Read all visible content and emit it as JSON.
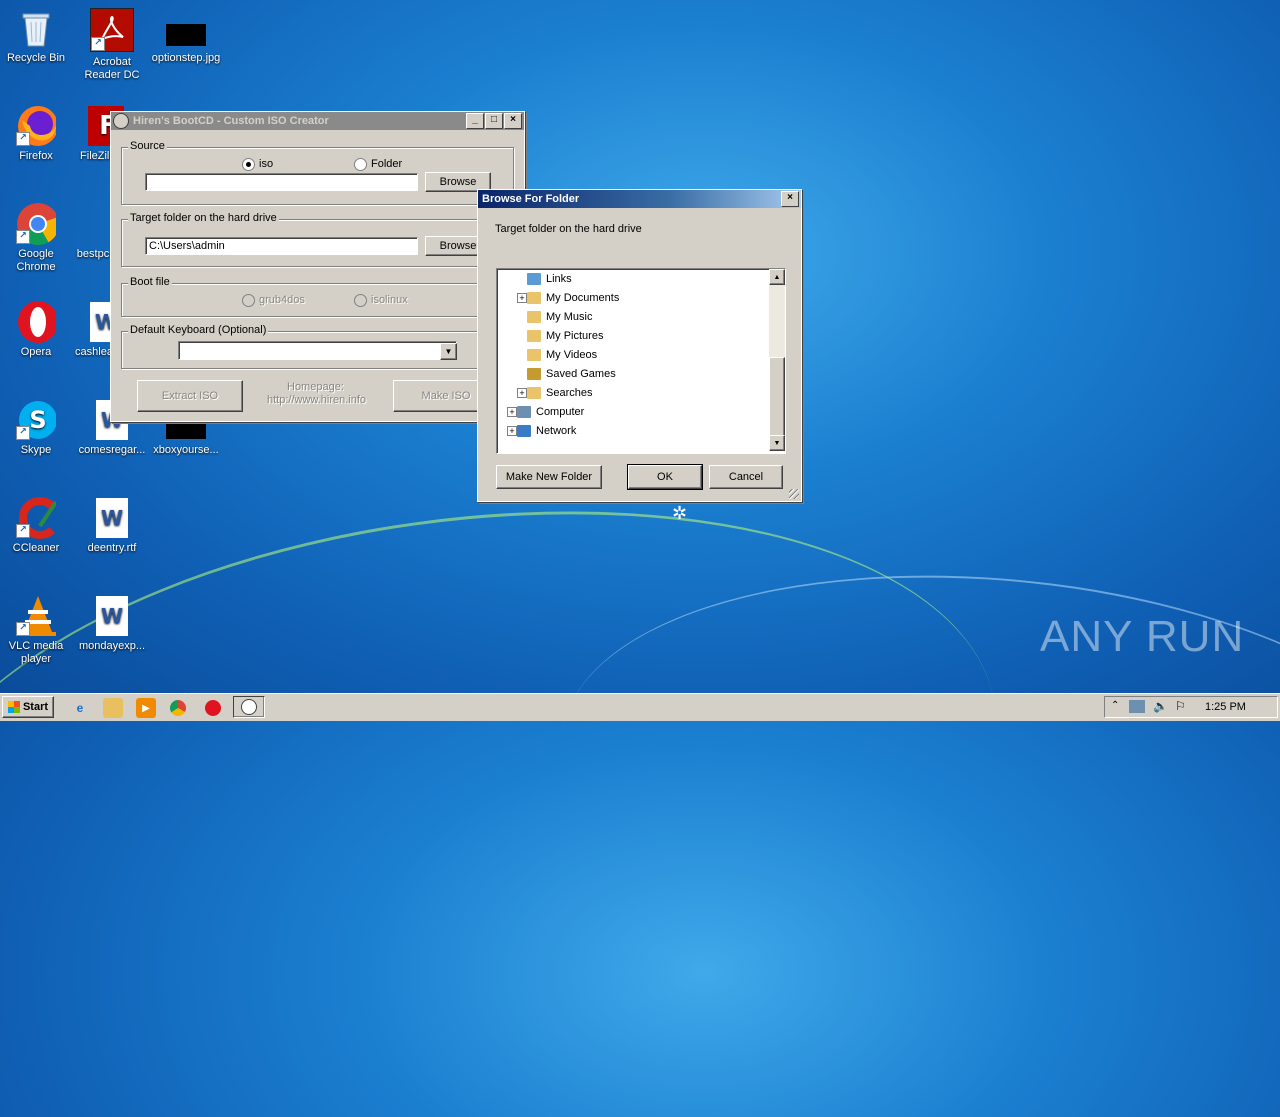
{
  "desktop": {
    "icons": [
      {
        "label": "Recycle Bin",
        "icon": "recycle-bin-icon"
      },
      {
        "label": "Acrobat Reader DC",
        "icon": "acrobat-icon"
      },
      {
        "label": "optionstep.jpg",
        "icon": "image-file-icon"
      },
      {
        "label": "Firefox",
        "icon": "firefox-icon"
      },
      {
        "label": "FileZilla",
        "icon": "filezilla-icon"
      },
      {
        "label": "Google Chrome",
        "icon": "chrome-icon"
      },
      {
        "label": "bestpc",
        "icon": "document-icon"
      },
      {
        "label": "Opera",
        "icon": "opera-icon"
      },
      {
        "label": "cashlea",
        "icon": "word-document-icon"
      },
      {
        "label": "Skype",
        "icon": "skype-icon"
      },
      {
        "label": "comesregar...",
        "icon": "word-document-icon"
      },
      {
        "label": "xboxyourse...",
        "icon": "image-file-icon"
      },
      {
        "label": "CCleaner",
        "icon": "ccleaner-icon"
      },
      {
        "label": "deentry.rtf",
        "icon": "word-document-icon"
      },
      {
        "label": "VLC media player",
        "icon": "vlc-icon"
      },
      {
        "label": "mondayexp...",
        "icon": "word-document-icon"
      }
    ],
    "watermark": "ANY RUN"
  },
  "hiren_window": {
    "title": "Hiren's BootCD - Custom ISO Creator",
    "source_group": "Source",
    "radio_iso": "iso",
    "radio_folder": "Folder",
    "source_value": "",
    "browse1": "Browse",
    "target_group": "Target folder on the hard drive",
    "target_value": "C:\\Users\\admin",
    "browse2": "Browse",
    "boot_group": "Boot file",
    "radio_grub": "grub4dos",
    "radio_isolinux": "isolinux",
    "keyboard_group": "Default Keyboard (Optional)",
    "keyboard_value": "",
    "extract_btn": "Extract ISO",
    "homepage_label": "Homepage:",
    "homepage_url": "http://www.hiren.info",
    "make_btn": "Make ISO"
  },
  "browse_dialog": {
    "title": "Browse For Folder",
    "description": "Target folder on the hard drive",
    "tree": [
      {
        "label": "Links",
        "expandable": false,
        "indent": 1,
        "icon": "folder-links-icon"
      },
      {
        "label": "My Documents",
        "expandable": true,
        "indent": 1,
        "icon": "folder-documents-icon"
      },
      {
        "label": "My Music",
        "expandable": false,
        "indent": 1,
        "icon": "folder-music-icon"
      },
      {
        "label": "My Pictures",
        "expandable": false,
        "indent": 1,
        "icon": "folder-pictures-icon"
      },
      {
        "label": "My Videos",
        "expandable": false,
        "indent": 1,
        "icon": "folder-videos-icon"
      },
      {
        "label": "Saved Games",
        "expandable": false,
        "indent": 1,
        "icon": "folder-games-icon"
      },
      {
        "label": "Searches",
        "expandable": true,
        "indent": 1,
        "icon": "folder-searches-icon"
      },
      {
        "label": "Computer",
        "expandable": true,
        "indent": 0,
        "icon": "computer-icon"
      },
      {
        "label": "Network",
        "expandable": true,
        "indent": 0,
        "icon": "network-icon"
      }
    ],
    "new_folder_btn": "Make New Folder",
    "ok_btn": "OK",
    "cancel_btn": "Cancel"
  },
  "taskbar": {
    "start_label": "Start",
    "clock": "1:25 PM"
  }
}
